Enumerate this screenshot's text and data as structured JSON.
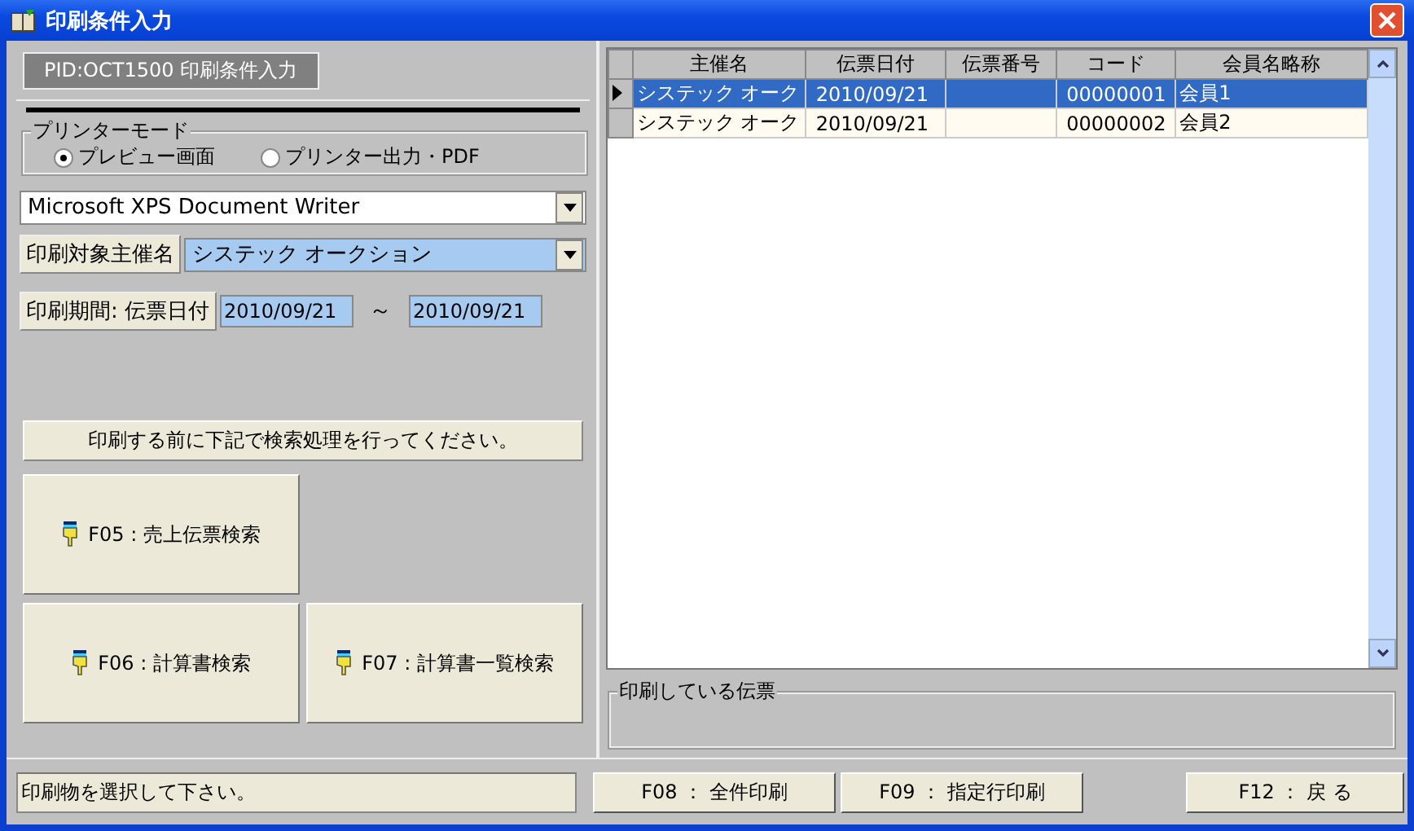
{
  "window": {
    "title": "印刷条件入力"
  },
  "pid_label": "PID:OCT1500 印刷条件入力",
  "printer_mode": {
    "label": "プリンターモード",
    "options": [
      {
        "label": "プレビュー画面",
        "selected": true
      },
      {
        "label": "プリンター出力・PDF",
        "selected": false
      }
    ]
  },
  "printer_select": {
    "value": "Microsoft XPS Document Writer"
  },
  "organizer": {
    "label": "印刷対象主催名",
    "value": "システック オークション"
  },
  "period": {
    "label": "印刷期間: 伝票日付",
    "from": "2010/09/21",
    "separator": "～",
    "to": "2010/09/21"
  },
  "notice": "印刷する前に下記で検索処理を行ってください。",
  "search_buttons": [
    {
      "label": "F05 : 売上伝票検索"
    },
    {
      "label": "F06 : 計算書検索"
    },
    {
      "label": "F07 : 計算書一覧検索"
    }
  ],
  "status": "印刷物を選択して下さい。",
  "table": {
    "columns": [
      "主催名",
      "伝票日付",
      "伝票番号",
      "コード",
      "会員名略称"
    ],
    "rows": [
      {
        "cells": [
          "システック オーク",
          "2010/09/21",
          "",
          "00000001",
          "会員1"
        ],
        "selected": true
      },
      {
        "cells": [
          "システック オーク",
          "2010/09/21",
          "",
          "00000002",
          "会員2"
        ],
        "selected": false
      }
    ]
  },
  "printing_group": {
    "label": "印刷している伝票"
  },
  "action_buttons": [
    {
      "label": "F08 ： 全件印刷"
    },
    {
      "label": "F09 ： 指定行印刷"
    },
    {
      "label": "F12 ： 戻 る"
    }
  ]
}
